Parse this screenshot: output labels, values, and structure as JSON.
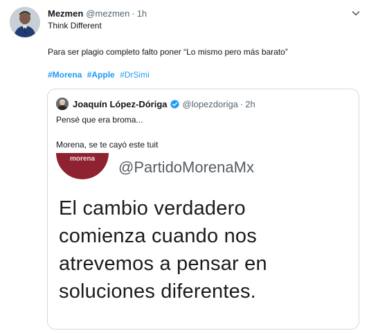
{
  "tweet": {
    "author_name": "Mezmen",
    "author_handle": "@mezmen",
    "separator": "·",
    "time": "1h",
    "line1": "Think Different",
    "line2": "Para ser plagio completo falto poner “Lo mismo pero más barato”",
    "hashtags": [
      {
        "text": "#Morena",
        "bold": true
      },
      {
        "text": "#Apple",
        "bold": true
      },
      {
        "text": "#DrSimi",
        "bold": false
      }
    ]
  },
  "quote": {
    "author_name": "Joaquín López-Dóriga",
    "author_handle": "@lopezdoriga",
    "separator": "·",
    "time": "2h",
    "line1": "Pensé que era broma...",
    "line2": "Morena, se te cayó este tuit",
    "image": {
      "logo_text": "morena",
      "handle": "@PartidoMorenaMx",
      "lines": [
        "El cambio verdadero",
        "comienza cuando nos",
        "atrevemos a pensar en",
        "soluciones diferentes."
      ]
    }
  },
  "icons": {
    "more": "chevron-down-icon",
    "verified": "verified-badge-icon"
  },
  "colors": {
    "link": "#1d9bf0",
    "muted": "#536471",
    "border": "#cfd9de",
    "morena": "#8e2230"
  }
}
